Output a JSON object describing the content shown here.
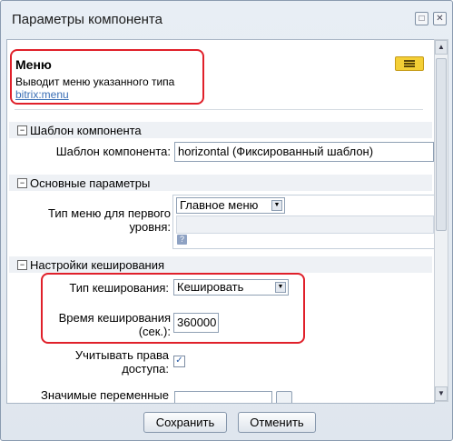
{
  "window": {
    "title": "Параметры компонента"
  },
  "component": {
    "name": "Меню",
    "description": "Выводит меню указанного типа",
    "code": "bitrix:menu"
  },
  "sections": {
    "template": {
      "title": "Шаблон компонента",
      "label": "Шаблон компонента:",
      "value": "horizontal (Фиксированный шаблон)"
    },
    "basic": {
      "title": "Основные параметры",
      "menu_type_label_line1": "Тип меню для первого",
      "menu_type_label_line2": "уровня:",
      "menu_type_value": "Главное меню"
    },
    "cache": {
      "title": "Настройки кеширования",
      "cache_type_label": "Тип кеширования:",
      "cache_type_value": "Кешировать",
      "cache_time_label_line1": "Время кеширования",
      "cache_time_label_line2": "(сек.):",
      "cache_time_value": "360000",
      "access_label_line1": "Учитывать права",
      "access_label_line2": "доступа:",
      "access_checked": true,
      "vars_label": "Значимые переменные"
    }
  },
  "footer": {
    "save_label": "Сохранить",
    "cancel_label": "Отменить"
  },
  "icons": {
    "toggle": "−",
    "help": "?",
    "check": "✓",
    "dropdown": "▼"
  },
  "colors": {
    "highlight": "#e0202a",
    "link": "#3a6eb5",
    "badge": "#f4cf36"
  }
}
